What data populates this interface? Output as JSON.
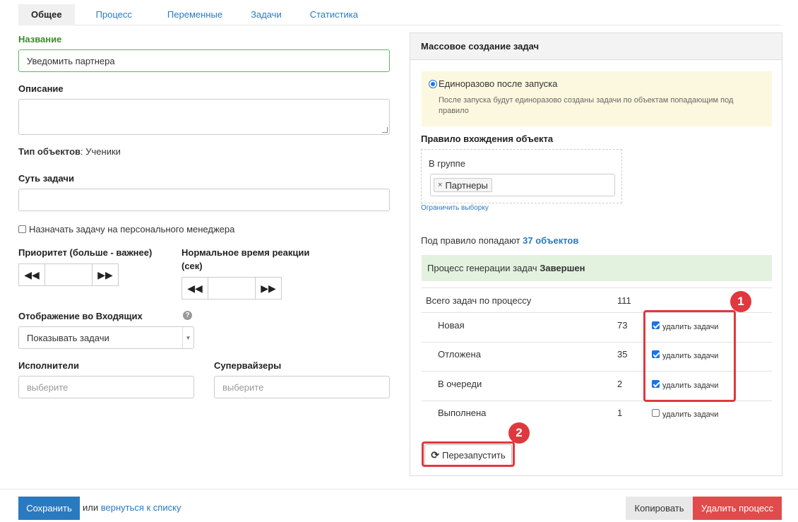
{
  "tabs": [
    "Общее",
    "Процесс",
    "Переменные",
    "Задачи",
    "Статистика"
  ],
  "left": {
    "name_label": "Название",
    "name_value": "Уведомить партнера",
    "description_label": "Описание",
    "object_type_label": "Тип объектов",
    "object_type_value": ": Ученики",
    "task_essence_label": "Суть задачи",
    "personal_manager_label": "Назначать задачу на персонального менеджера",
    "priority_label": "Приоритет (больше - важнее)",
    "reaction_label_line1": "Нормальное время реакции",
    "reaction_label_line2": "(сек)",
    "inbox_label": "Отображение во Входящих",
    "inbox_value": "Показывать задачи",
    "executors_label": "Исполнители",
    "executors_placeholder": "выберите",
    "supervisors_label": "Супервайзеры",
    "supervisors_placeholder": "выберите"
  },
  "panel": {
    "title": "Массовое создание задач",
    "radio_label": "Единоразово после запуска",
    "radio_desc_line1": "После запуска будут единоразово созданы задачи по объектам попадающим под",
    "radio_desc_line2": "правило",
    "rule_label": "Правило вхождения объекта",
    "group_label": "В группе",
    "group_tag": "Партнеры",
    "restrict_link": "Ограничить выборку",
    "matches_prefix": "Под правило попадают",
    "matches_value": "37 объектов",
    "status_prefix": "Процесс генерации задач",
    "status_value": "Завершен",
    "total_label": "Всего задач по процессу",
    "total_value": "111",
    "rows": [
      {
        "label": "Новая",
        "value": "73",
        "checked": true,
        "action": "удалить задачи"
      },
      {
        "label": "Отложена",
        "value": "35",
        "checked": true,
        "action": "удалить задачи"
      },
      {
        "label": "В очереди",
        "value": "2",
        "checked": true,
        "action": "удалить задачи"
      },
      {
        "label": "Выполнена",
        "value": "1",
        "checked": false,
        "action": "удалить задачи"
      }
    ],
    "restart_label": "Перезапустить",
    "badge1": "1",
    "badge2": "2"
  },
  "footer": {
    "save_label": "Сохранить",
    "or_text": "или",
    "back_link": "вернуться к списку",
    "copy_label": "Копировать",
    "delete_label": "Удалить процесс"
  },
  "colors": {
    "accent": "#2a7ac0",
    "highlight_red": "#e0383e",
    "success_bg": "#e3f2df",
    "info_bg": "#fcf8df"
  }
}
